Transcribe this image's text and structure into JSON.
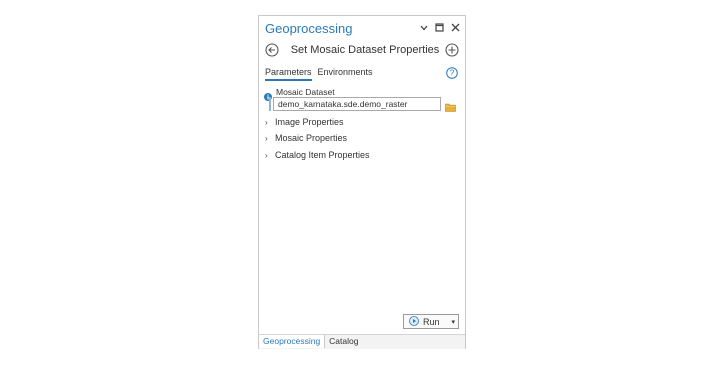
{
  "pane": {
    "title": "Geoprocessing",
    "tool_name": "Set Mosaic Dataset Properties",
    "tabs": [
      {
        "label": "Parameters",
        "active": true
      },
      {
        "label": "Environments",
        "active": false
      }
    ],
    "parameter": {
      "label": "Mosaic Dataset",
      "value": "demo_karnataka.sde.demo_raster"
    },
    "groups": [
      {
        "label": "Image Properties"
      },
      {
        "label": "Mosaic Properties"
      },
      {
        "label": "Catalog Item Properties"
      }
    ],
    "run_label": "Run",
    "bottom_tabs": [
      {
        "label": "Geoprocessing",
        "active": true
      },
      {
        "label": "Catalog",
        "active": false
      }
    ]
  },
  "colors": {
    "accent": "#2a7ab8",
    "folder": "#e8b23a"
  }
}
